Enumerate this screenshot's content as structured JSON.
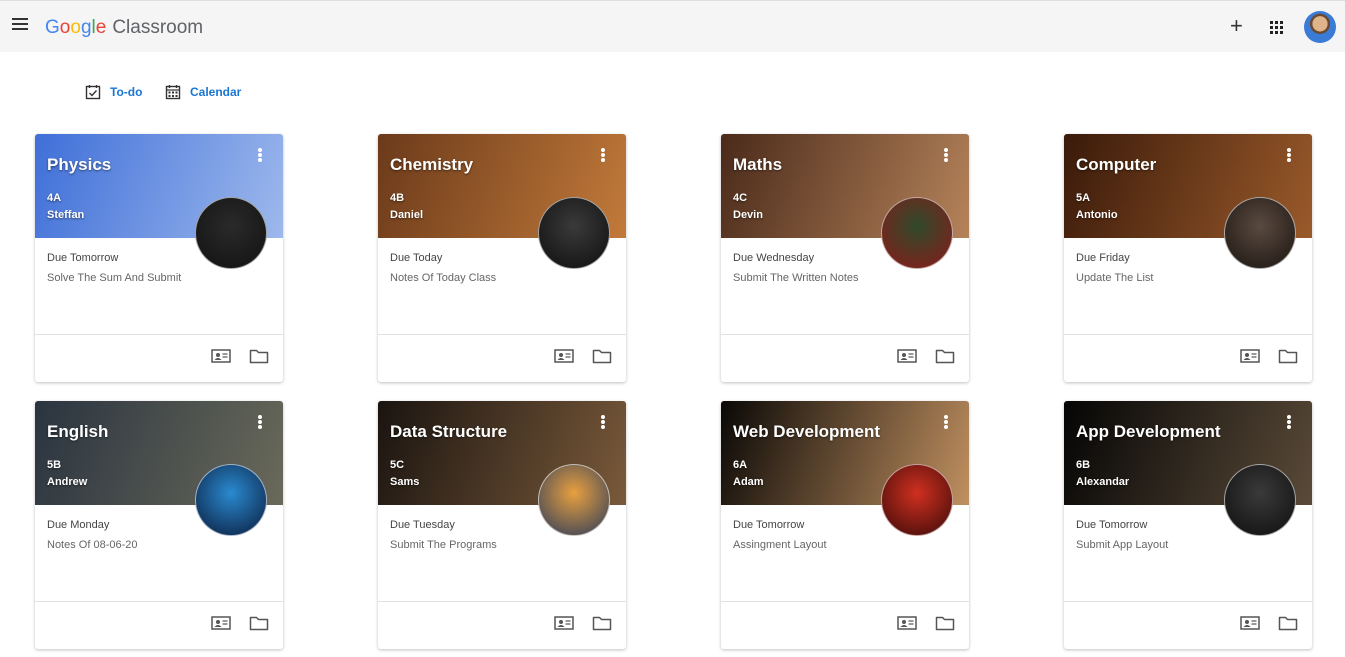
{
  "header": {
    "brand": {
      "g1": "G",
      "g2": "o",
      "g3": "o",
      "g4": "g",
      "g5": "l",
      "g6": "e",
      "app_name": "Classroom"
    },
    "plus_glyph": "+"
  },
  "subnav": {
    "todo_label": "To-do",
    "calendar_label": "Calendar"
  },
  "colors": {
    "accent": "#1976d2",
    "topbar_bg": "#f5f5f5"
  },
  "icons": [
    "menu-icon",
    "plus-icon",
    "apps-grid-icon",
    "account-avatar",
    "todo-checkbox-icon",
    "calendar-icon",
    "more-vert-icon",
    "student-id-icon",
    "folder-icon"
  ],
  "cards": [
    {
      "title": "Physics",
      "section": "4A",
      "teacher": "Steffan",
      "due": "Due Tomorrow",
      "task": "Solve The Sum And Submit",
      "header_colors": [
        "#3f6fd8",
        "#9db8ec"
      ],
      "avatar_colors": [
        "#2a2a2a",
        "#111111"
      ]
    },
    {
      "title": "Chemistry",
      "section": "4B",
      "teacher": "Daniel",
      "due": "Due Today",
      "task": "Notes Of Today Class",
      "header_colors": [
        "#6b3a1a",
        "#c27a3a"
      ],
      "avatar_colors": [
        "#3a3a3a",
        "#0e0e0e"
      ]
    },
    {
      "title": "Maths",
      "section": "4C",
      "teacher": "Devin",
      "due": "Due Wednesday",
      "task": "Submit The Written Notes",
      "header_colors": [
        "#4a2a1a",
        "#b5835a"
      ],
      "avatar_colors": [
        "#2f4a2a",
        "#8a1a1a"
      ]
    },
    {
      "title": "Computer",
      "section": "5A",
      "teacher": "Antonio",
      "due": "Due Friday",
      "task": "Update The List",
      "header_colors": [
        "#3a1a0a",
        "#9a5a2a"
      ],
      "avatar_colors": [
        "#5a4a40",
        "#1a1410"
      ]
    },
    {
      "title": "English",
      "section": "5B",
      "teacher": "Andrew",
      "due": "Due Monday",
      "task": "Notes Of 08-06-20",
      "header_colors": [
        "#2a3440",
        "#6a6a5a"
      ],
      "avatar_colors": [
        "#2a8ad0",
        "#0a1a3a"
      ]
    },
    {
      "title": "Data Structure",
      "section": "5C",
      "teacher": "Sams",
      "due": "Due Tuesday",
      "task": "Submit The Programs",
      "header_colors": [
        "#1a1410",
        "#7a5a3a"
      ],
      "avatar_colors": [
        "#e8a040",
        "#2a3a5a"
      ]
    },
    {
      "title": "Web Development",
      "section": "6A",
      "teacher": "Adam",
      "due": "Due Tomorrow",
      "task": "Assingment Layout",
      "header_colors": [
        "#0a0806",
        "#c09060"
      ],
      "avatar_colors": [
        "#d03020",
        "#3a0a08"
      ]
    },
    {
      "title": "App Development",
      "section": "6B",
      "teacher": "Alexandar",
      "due": "Due Tomorrow",
      "task": "Submit App Layout",
      "header_colors": [
        "#050505",
        "#5a4a38"
      ],
      "avatar_colors": [
        "#3a3a3a",
        "#0e0e0e"
      ]
    }
  ]
}
